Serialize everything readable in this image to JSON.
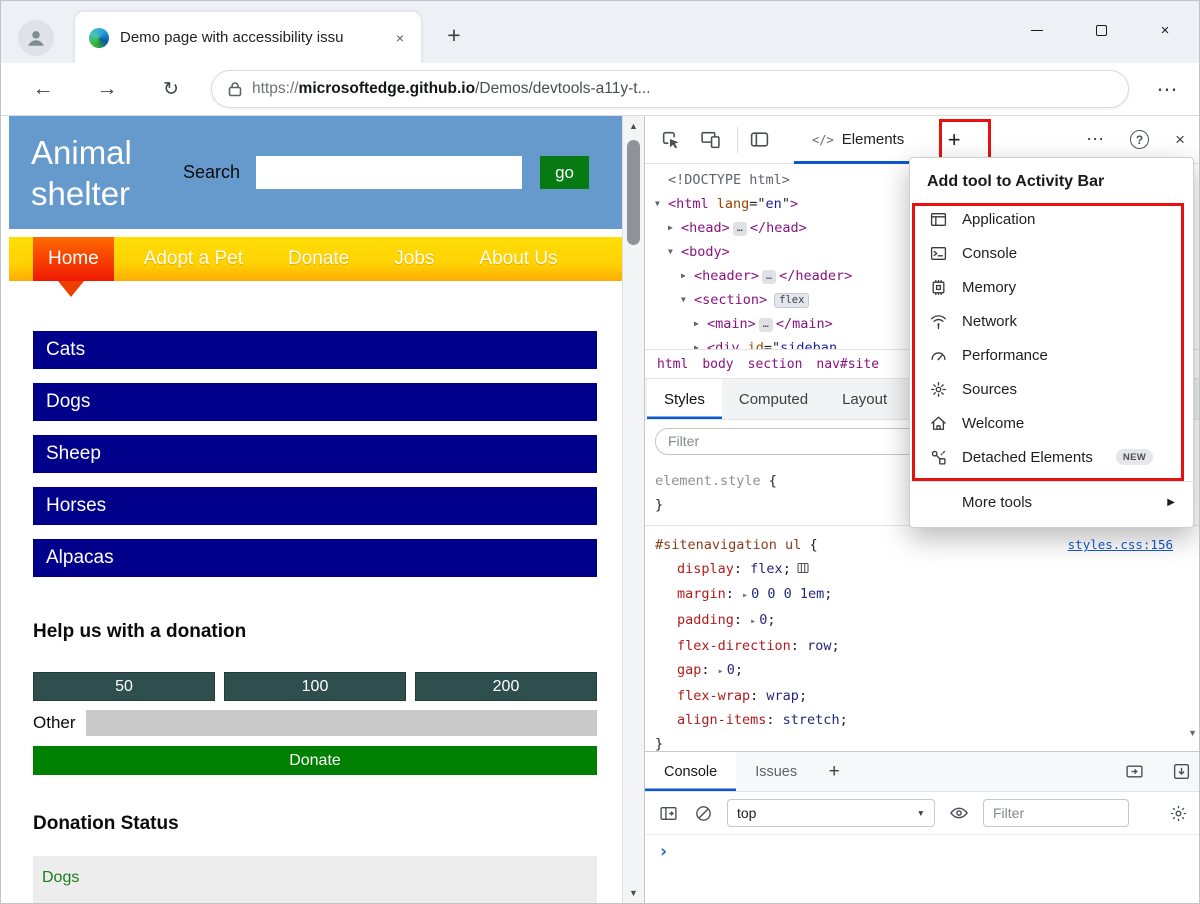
{
  "accent": {
    "annotation_red": "#e8110f",
    "devtools_blue": "#0b57d0"
  },
  "icons": {
    "close-icon": "×",
    "add-icon": "+",
    "more-icon": "⋯",
    "help-icon": "?",
    "back-icon": "←",
    "forward-icon": "→",
    "refresh-icon": "↻",
    "caret-up-icon": "▲",
    "caret-down-icon": "▼",
    "caret-right-icon": "▸",
    "expand-right-icon": "▶",
    "prompt-icon": "›",
    "menu-arrow-icon": "▶"
  },
  "browser": {
    "tab_title": "Demo page with accessibility issu",
    "url_scheme": "https://",
    "url_domain": "microsoftedge.github.io",
    "url_path": "/Demos/devtools-a11y-t..."
  },
  "page": {
    "site_title": "Animal shelter",
    "search_label": "Search",
    "go_button": "go",
    "nav_items": [
      "Home",
      "Adopt a Pet",
      "Donate",
      "Jobs",
      "About Us"
    ],
    "active_nav": "Home",
    "animals": [
      "Cats",
      "Dogs",
      "Sheep",
      "Horses",
      "Alpacas"
    ],
    "donation_heading": "Help us with a donation",
    "donation_amounts": [
      "50",
      "100",
      "200"
    ],
    "other_label": "Other",
    "donate_button": "Donate",
    "status_heading": "Donation Status",
    "status_item": "Dogs"
  },
  "devtools": {
    "elements_tab_icon": "</>",
    "elements_tab_label": "Elements",
    "syntax": {
      "open": "{",
      "close": "}",
      "colon": ":",
      "semi": ";"
    },
    "dom_lines": [
      {
        "indent": 0,
        "arrow": "",
        "spans": [
          [
            "doctype",
            "<!DOCTYPE html>"
          ]
        ]
      },
      {
        "indent": 0,
        "arrow": "d",
        "spans": [
          [
            "tag",
            "<html"
          ],
          [
            "attr",
            " lang"
          ],
          [
            "punct",
            "=\""
          ],
          [
            "val",
            "en"
          ],
          [
            "punct",
            "\""
          ],
          [
            "tag",
            ">"
          ]
        ]
      },
      {
        "indent": 1,
        "arrow": "r",
        "spans": [
          [
            "tag",
            "<head>"
          ],
          [
            "ellipsis",
            "…"
          ],
          [
            "tag",
            "</head>"
          ]
        ]
      },
      {
        "indent": 1,
        "arrow": "d",
        "spans": [
          [
            "tag",
            "<body>"
          ]
        ]
      },
      {
        "indent": 2,
        "arrow": "r",
        "spans": [
          [
            "tag",
            "<header>"
          ],
          [
            "ellipsis",
            "…"
          ],
          [
            "tag",
            "</header>"
          ]
        ]
      },
      {
        "indent": 2,
        "arrow": "d",
        "spans": [
          [
            "tag",
            "<section>"
          ],
          [
            "badge",
            "flex"
          ]
        ]
      },
      {
        "indent": 3,
        "arrow": "r",
        "spans": [
          [
            "tag",
            "<main>"
          ],
          [
            "ellipsis",
            "…"
          ],
          [
            "tag",
            "</main>"
          ]
        ]
      },
      {
        "indent": 3,
        "arrow": "r",
        "spans": [
          [
            "tag",
            "<div"
          ],
          [
            "attr",
            " id"
          ],
          [
            "punct",
            "=\""
          ],
          [
            "val",
            "sideban"
          ]
        ]
      }
    ],
    "breadcrumbs": [
      "html",
      "body",
      "section",
      "nav#site"
    ],
    "styles_tabs": [
      "Styles",
      "Computed",
      "Layout"
    ],
    "active_styles_tab": "Styles",
    "styles_filter_placeholder": "Filter",
    "element_style_selector": "element.style",
    "rule": {
      "selector": "#sitenavigation ul",
      "source_link": "styles.css:156",
      "properties": [
        {
          "name": "display",
          "value": "flex",
          "flex_icon": true
        },
        {
          "name": "margin",
          "value": "0 0 0 1em",
          "expandable": true
        },
        {
          "name": "padding",
          "value": "0",
          "expandable": true
        },
        {
          "name": "flex-direction",
          "value": "row"
        },
        {
          "name": "gap",
          "value": "0",
          "expandable": true
        },
        {
          "name": "flex-wrap",
          "value": "wrap"
        },
        {
          "name": "align-items",
          "value": "stretch"
        }
      ]
    },
    "drawer": {
      "tabs": [
        "Console",
        "Issues"
      ],
      "active_tab": "Console",
      "context_selector": "top",
      "filter_placeholder": "Filter"
    },
    "menu": {
      "title": "Add tool to Activity Bar",
      "items": [
        {
          "label": "Application",
          "icon": "application-icon"
        },
        {
          "label": "Console",
          "icon": "console-icon"
        },
        {
          "label": "Memory",
          "icon": "memory-icon"
        },
        {
          "label": "Network",
          "icon": "network-icon"
        },
        {
          "label": "Performance",
          "icon": "performance-icon"
        },
        {
          "label": "Sources",
          "icon": "sources-icon"
        },
        {
          "label": "Welcome",
          "icon": "welcome-icon"
        },
        {
          "label": "Detached Elements",
          "icon": "detached-elements-icon",
          "badge": "NEW"
        }
      ],
      "more_tools": "More tools"
    }
  }
}
